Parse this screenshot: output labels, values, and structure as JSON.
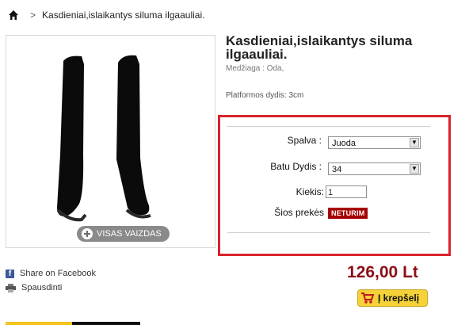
{
  "breadcrumb": {
    "separator": ">",
    "current": "Kasdieniai,islaikantys siluma ilgaauliai."
  },
  "product": {
    "title": "Kasdieniai,islaikantys siluma ilgaauliai.",
    "material": "Medžiaga : Oda,",
    "platform": "Platformos dydis: 3cm",
    "zoom_label": "VISAS VAIZDAS"
  },
  "options": {
    "color_label": "Spalva :",
    "color_value": "Juoda",
    "size_label": "Batu Dydis :",
    "size_value": "34",
    "qty_label": "Kiekis:",
    "qty_value": "1",
    "stock_label": "Šios prekės",
    "stock_badge": "NETURIM"
  },
  "purchase": {
    "price": "126,00 Lt",
    "cart_label": "Į krepšelį"
  },
  "share": {
    "facebook": "Share on Facebook",
    "print": "Spausdinti"
  },
  "colors": {
    "accent_red": "#d9232d",
    "price": "#8b0f15",
    "cart": "#f5d238",
    "badge": "#a60000"
  },
  "icons": [
    "home-icon",
    "zoom-icon",
    "cart-icon",
    "facebook-icon",
    "print-icon",
    "chevron-down-icon"
  ]
}
